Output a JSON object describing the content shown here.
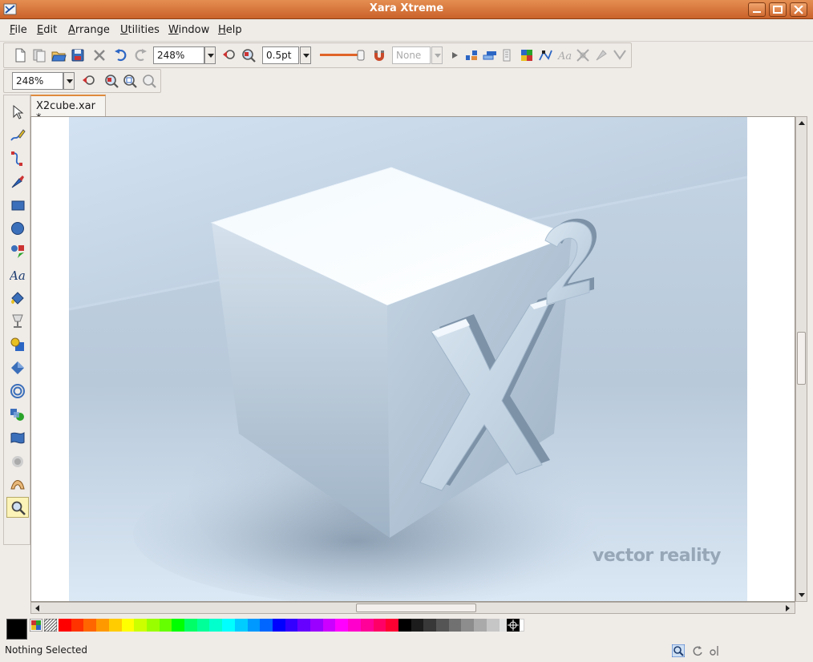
{
  "window": {
    "title": "Xara Xtreme",
    "controls": [
      "minimize",
      "maximize",
      "close"
    ]
  },
  "menu": [
    {
      "label": "File",
      "mnemonic": "F",
      "rest": "ile"
    },
    {
      "label": "Edit",
      "mnemonic": "E",
      "rest": "dit"
    },
    {
      "label": "Arrange",
      "mnemonic": "A",
      "rest": "rrange"
    },
    {
      "label": "Utilities",
      "mnemonic": "U",
      "rest": "tilities"
    },
    {
      "label": "Window",
      "mnemonic": "W",
      "rest": "indow"
    },
    {
      "label": "Help",
      "mnemonic": "H",
      "rest": "elp"
    }
  ],
  "toolbar_main": {
    "zoom_value": "248%",
    "line_width_value": "0.5pt",
    "transparency_type": "None",
    "icons": [
      "new-document-icon",
      "open-template-icon",
      "open-icon",
      "save-icon",
      "delete-icon",
      "undo-icon",
      "redo-icon",
      "zoom-previous-icon",
      "zoom-drawing-icon",
      "slider-icon",
      "snap-magnet-icon",
      "next-arrow-icon",
      "align-icon",
      "arrange-icon",
      "layers-icon",
      "colour-icon",
      "edit-points-icon",
      "text-icon",
      "transform-icon",
      "effects-icon"
    ]
  },
  "toolbar_zoom": {
    "zoom_value": "248%",
    "icons": [
      "zoom-previous-icon",
      "zoom-selected-icon",
      "zoom-page-icon",
      "zoom-drawing-icon"
    ]
  },
  "tools": [
    "selector-tool-icon",
    "freehand-tool-icon",
    "bezier-tool-icon",
    "pen-tool-icon",
    "rectangle-tool-icon",
    "ellipse-tool-icon",
    "quickshape-tool-icon",
    "text-tool-icon",
    "fill-tool-icon",
    "transparency-tool-icon",
    "shadow-tool-icon",
    "bevel-tool-icon",
    "contour-tool-icon",
    "blend-tool-icon",
    "mould-tool-icon",
    "live-effects-tool-icon",
    "push-tool-icon",
    "zoom-tool-icon"
  ],
  "active_tool": "zoom-tool-icon",
  "document": {
    "tab_label": "X2cube.xar *",
    "watermark_text": "vector reality"
  },
  "palette": {
    "current_fill": "#000000",
    "colors": [
      "#ff0000",
      "#ff3300",
      "#ff6600",
      "#ff9900",
      "#ffcc00",
      "#ffff00",
      "#ccff00",
      "#99ff00",
      "#66ff00",
      "#00ff00",
      "#00ff66",
      "#00ff99",
      "#00ffcc",
      "#00ffff",
      "#00ccff",
      "#0099ff",
      "#0066ff",
      "#0000ff",
      "#3300ff",
      "#6600ff",
      "#9900ff",
      "#cc00ff",
      "#ff00ff",
      "#ff00cc",
      "#ff0099",
      "#ff0066",
      "#ff0033",
      "#000000",
      "#1c1c1c",
      "#383838",
      "#555555",
      "#717171",
      "#8d8d8d",
      "#aaaaaa",
      "#c6c6c6",
      "#e2e2e2",
      "#ffffff"
    ]
  },
  "status": {
    "text": "Nothing Selected"
  }
}
